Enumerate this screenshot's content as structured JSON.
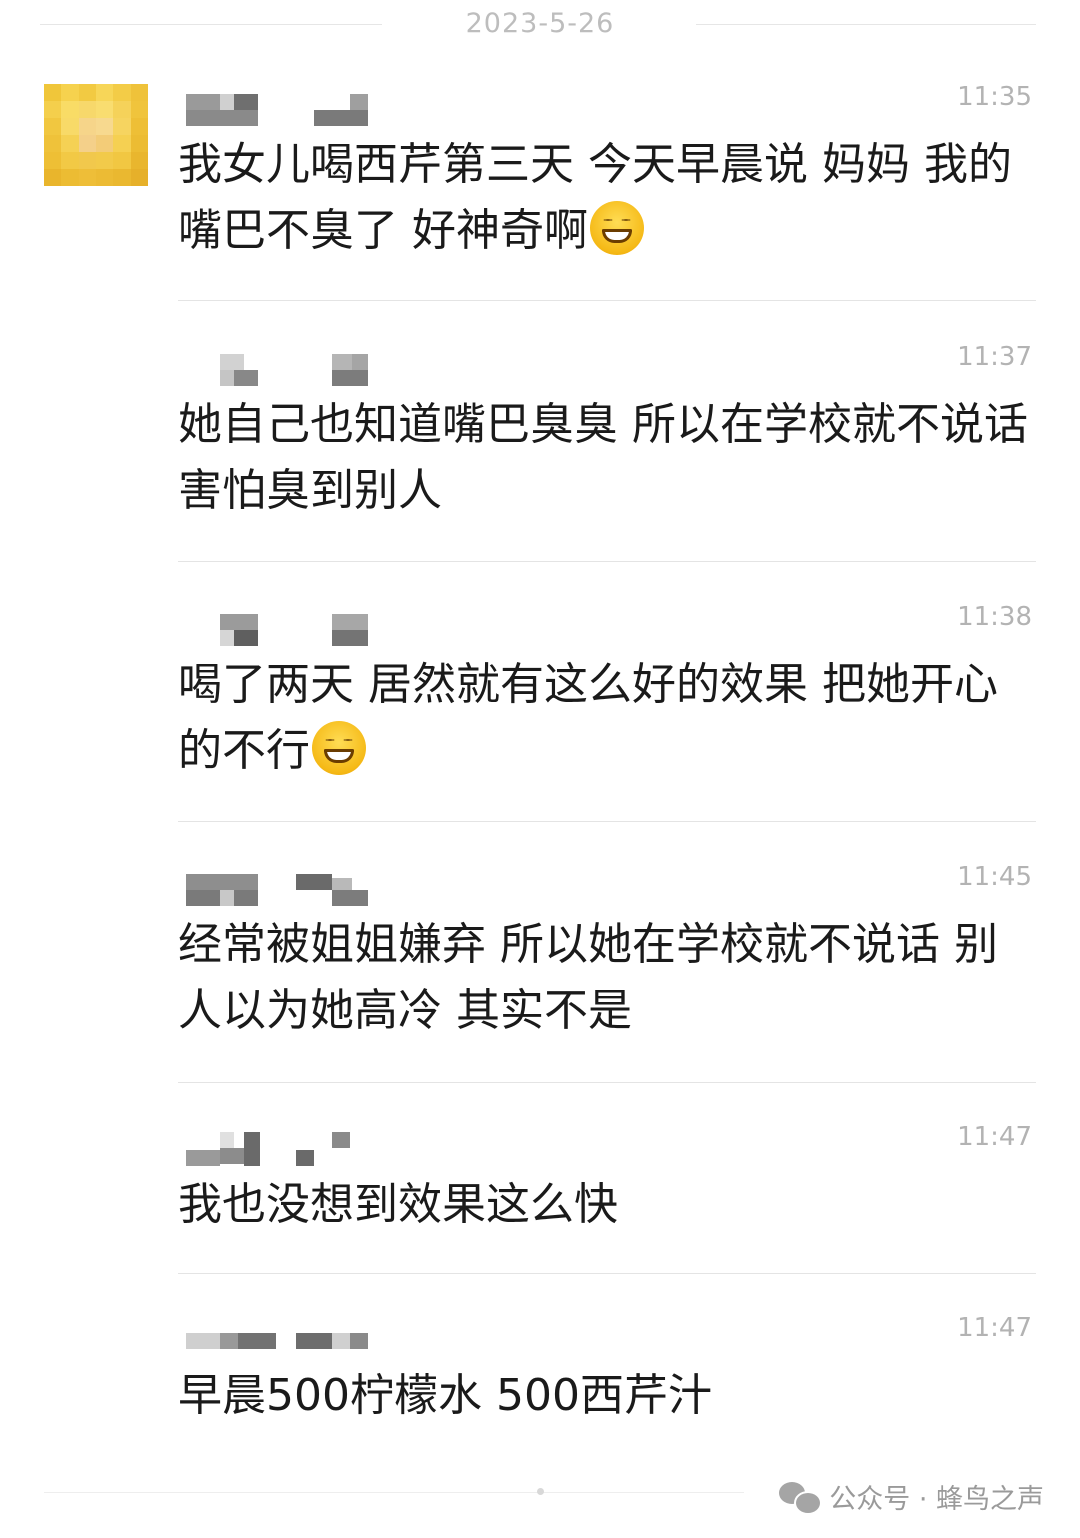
{
  "date_divider": "2023-5-26",
  "messages": [
    {
      "time": "11:35",
      "text": "我女儿喝西芹第三天 今天早晨说 妈妈 我的嘴巴不臭了 好神奇啊",
      "emoji": "grinning-face-emoji"
    },
    {
      "time": "11:37",
      "text": "她自己也知道嘴巴臭臭 所以在学校就不说话 害怕臭到别人"
    },
    {
      "time": "11:38",
      "text": "喝了两天 居然就有这么好的效果 把她开心的不行",
      "emoji": "grinning-face-emoji"
    },
    {
      "time": "11:45",
      "text": "经常被姐姐嫌弃 所以她在学校就不说话 别人以为她高冷 其实不是"
    },
    {
      "time": "11:47",
      "text": "我也没想到效果这么快"
    },
    {
      "time": "11:47",
      "text": "早晨500柠檬水 500西芹汁"
    }
  ],
  "watermark": {
    "icon": "wechat-icon",
    "text": "公众号 · 蜂鸟之声"
  }
}
